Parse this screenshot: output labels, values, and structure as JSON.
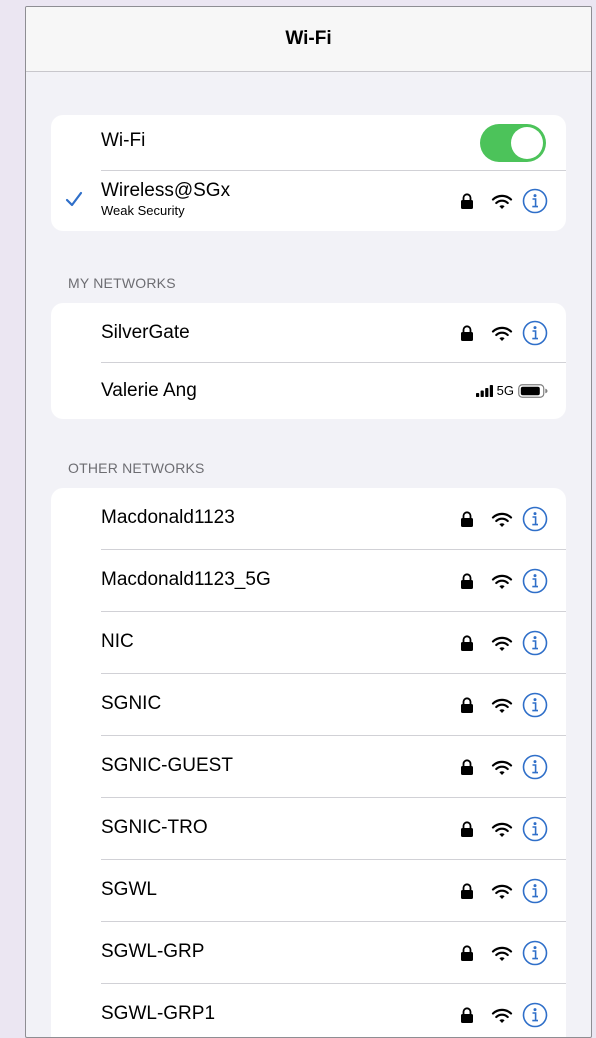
{
  "navbar": {
    "title": "Wi-Fi"
  },
  "wifi_group": {
    "toggle_label": "Wi-Fi",
    "toggle_on": true,
    "connected": {
      "name": "Wireless@SGx",
      "subtitle": "Weak Security"
    }
  },
  "my_networks": {
    "header": "MY NETWORKS",
    "items": [
      {
        "name": "SilverGate"
      },
      {
        "name": "Valerie Ang",
        "cellular": "5G"
      }
    ]
  },
  "other_networks": {
    "header": "OTHER NETWORKS",
    "items": [
      {
        "name": "Macdonald1123"
      },
      {
        "name": "Macdonald1123_5G"
      },
      {
        "name": "NIC"
      },
      {
        "name": "SGNIC"
      },
      {
        "name": "SGNIC-GUEST"
      },
      {
        "name": "SGNIC-TRO"
      },
      {
        "name": "SGWL"
      },
      {
        "name": "SGWL-GRP"
      },
      {
        "name": "SGWL-GRP1"
      }
    ]
  },
  "colors": {
    "accent": "#2f6fc9",
    "toggle_on": "#4cc35a",
    "background": "#ebe6f2"
  },
  "icons": {
    "lock": "lock-icon",
    "wifi": "wifi-icon",
    "info": "info-icon",
    "check": "checkmark-icon"
  }
}
